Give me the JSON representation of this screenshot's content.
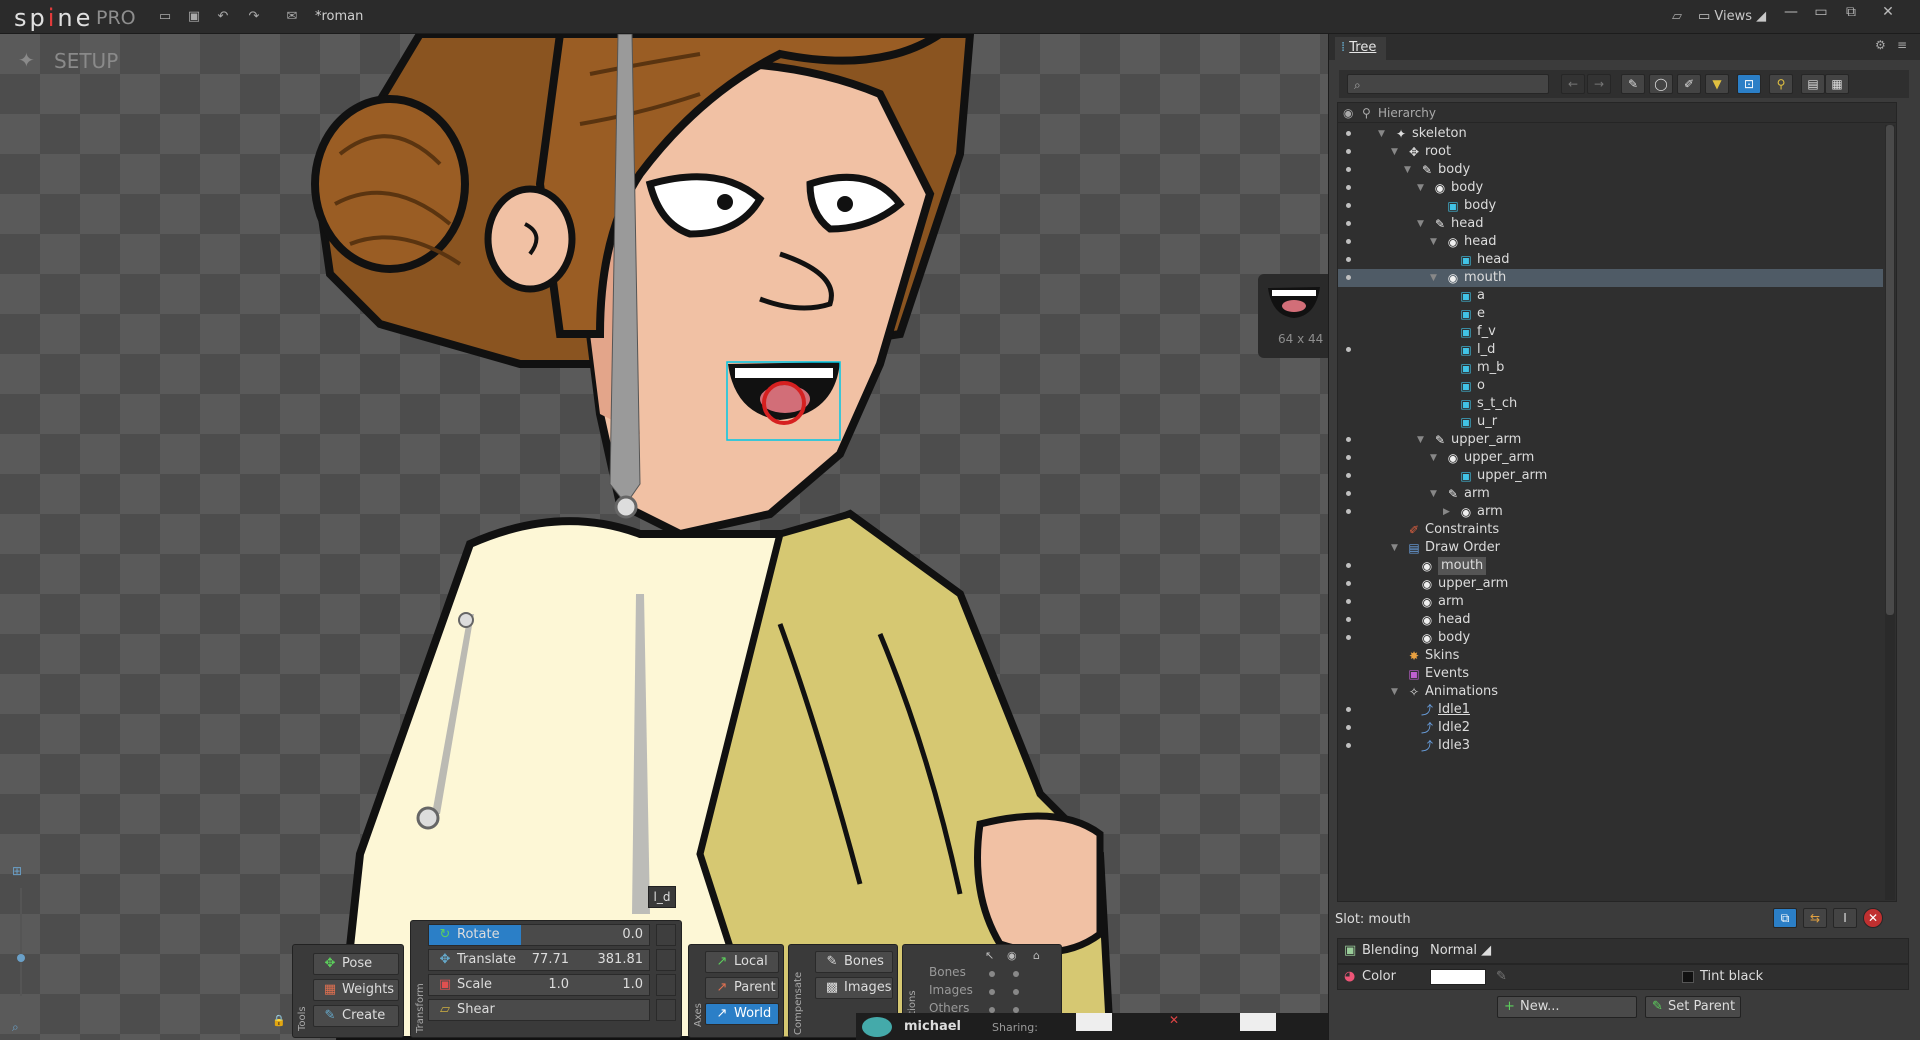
{
  "app": {
    "logo": "spine",
    "edition": "PRO",
    "filename": "*roman",
    "views_label": "Views"
  },
  "colors": {
    "accent": "#2b7fc7",
    "attachment": "#41c3e6",
    "selection": "#4f5b66",
    "bound_box": "#00c8e6",
    "handle_red": "#d62020"
  },
  "viewport": {
    "mode_label": "SETUP",
    "image_size_label": "64 x 44",
    "bone_tag": "l_d"
  },
  "tools": {
    "section_label": "Tools",
    "pose": "Pose",
    "weights": "Weights",
    "create": "Create"
  },
  "transform": {
    "section_label": "Transform",
    "rotate": {
      "label": "Rotate",
      "value": "0.0"
    },
    "translate": {
      "label": "Translate",
      "x": "77.71",
      "y": "381.81"
    },
    "scale": {
      "label": "Scale",
      "x": "1.0",
      "y": "1.0"
    },
    "shear": {
      "label": "Shear",
      "x": "",
      "y": ""
    }
  },
  "axes": {
    "section_label": "Axes",
    "local": "Local",
    "parent": "Parent",
    "world": "World"
  },
  "compensate": {
    "section_label": "Compensate",
    "bones": "Bones",
    "images": "Images"
  },
  "options": {
    "section_label": "Options",
    "bones": "Bones",
    "images": "Images",
    "others": "Others"
  },
  "bottom": {
    "user": "michael",
    "sharing": "Sharing:"
  },
  "tree": {
    "tab_label": "Tree",
    "search_placeholder": "",
    "header": "Hierarchy",
    "rows": [
      {
        "label": "skeleton",
        "icon": "skeleton-icon",
        "indent": 0,
        "arrow": "▼",
        "eye": true
      },
      {
        "label": "root",
        "icon": "root-bone-icon",
        "indent": 1,
        "arrow": "▼",
        "eye": true
      },
      {
        "label": "body",
        "icon": "bone-icon",
        "indent": 2,
        "arrow": "▼",
        "eye": true
      },
      {
        "label": "body",
        "icon": "slot-icon",
        "indent": 3,
        "arrow": "▼",
        "eye": true
      },
      {
        "label": "body",
        "icon": "region-attachment-icon",
        "indent": 4,
        "arrow": "",
        "eye": true
      },
      {
        "label": "head",
        "icon": "bone-icon",
        "indent": 3,
        "arrow": "▼",
        "eye": true
      },
      {
        "label": "head",
        "icon": "slot-icon",
        "indent": 4,
        "arrow": "▼",
        "eye": true
      },
      {
        "label": "head",
        "icon": "region-attachment-icon",
        "indent": 5,
        "arrow": "",
        "eye": true
      },
      {
        "label": "mouth",
        "icon": "slot-icon",
        "indent": 4,
        "arrow": "▼",
        "eye": true,
        "selected": true
      },
      {
        "label": "a",
        "icon": "region-attachment-icon",
        "indent": 5,
        "arrow": "",
        "eye": false
      },
      {
        "label": "e",
        "icon": "region-attachment-icon",
        "indent": 5,
        "arrow": "",
        "eye": false
      },
      {
        "label": "f_v",
        "icon": "region-attachment-icon",
        "indent": 5,
        "arrow": "",
        "eye": false
      },
      {
        "label": "l_d",
        "icon": "region-attachment-icon",
        "indent": 5,
        "arrow": "",
        "eye": true
      },
      {
        "label": "m_b",
        "icon": "region-attachment-icon",
        "indent": 5,
        "arrow": "",
        "eye": false
      },
      {
        "label": "o",
        "icon": "region-attachment-icon",
        "indent": 5,
        "arrow": "",
        "eye": false
      },
      {
        "label": "s_t_ch",
        "icon": "region-attachment-icon",
        "indent": 5,
        "arrow": "",
        "eye": false
      },
      {
        "label": "u_r",
        "icon": "region-attachment-icon",
        "indent": 5,
        "arrow": "",
        "eye": false
      },
      {
        "label": "upper_arm",
        "icon": "bone-icon",
        "indent": 3,
        "arrow": "▼",
        "eye": true
      },
      {
        "label": "upper_arm",
        "icon": "slot-icon",
        "indent": 4,
        "arrow": "▼",
        "eye": true
      },
      {
        "label": "upper_arm",
        "icon": "region-attachment-icon",
        "indent": 5,
        "arrow": "",
        "eye": true
      },
      {
        "label": "arm",
        "icon": "bone-icon",
        "indent": 4,
        "arrow": "▼",
        "eye": true
      },
      {
        "label": "arm",
        "icon": "slot-icon",
        "indent": 5,
        "arrow": "▶",
        "eye": true
      },
      {
        "label": "Constraints",
        "icon": "constraints-icon",
        "indent": 1,
        "arrow": "",
        "eye": false
      },
      {
        "label": "Draw Order",
        "icon": "draw-order-icon",
        "indent": 1,
        "arrow": "▼",
        "eye": false
      },
      {
        "label": "mouth",
        "icon": "slot-icon",
        "indent": 2,
        "arrow": "",
        "eye": true,
        "highlight": true
      },
      {
        "label": "upper_arm",
        "icon": "slot-icon",
        "indent": 2,
        "arrow": "",
        "eye": true
      },
      {
        "label": "arm",
        "icon": "slot-icon",
        "indent": 2,
        "arrow": "",
        "eye": true
      },
      {
        "label": "head",
        "icon": "slot-icon",
        "indent": 2,
        "arrow": "",
        "eye": true
      },
      {
        "label": "body",
        "icon": "slot-icon",
        "indent": 2,
        "arrow": "",
        "eye": true
      },
      {
        "label": "Skins",
        "icon": "skins-icon",
        "indent": 1,
        "arrow": "",
        "eye": false
      },
      {
        "label": "Events",
        "icon": "events-icon",
        "indent": 1,
        "arrow": "",
        "eye": false
      },
      {
        "label": "Animations",
        "icon": "animations-icon",
        "indent": 1,
        "arrow": "▼",
        "eye": false
      },
      {
        "label": "Idle1",
        "icon": "animation-icon",
        "indent": 2,
        "arrow": "",
        "eye": true,
        "underline": true
      },
      {
        "label": "Idle2",
        "icon": "animation-icon",
        "indent": 2,
        "arrow": "",
        "eye": true
      },
      {
        "label": "Idle3",
        "icon": "animation-icon",
        "indent": 2,
        "arrow": "",
        "eye": true
      }
    ]
  },
  "slot": {
    "title": "Slot: mouth",
    "blending_label": "Blending",
    "blending_value": "Normal",
    "color_label": "Color",
    "color_value": "#ffffff",
    "tint_black_label": "Tint black",
    "new_button": "New...",
    "set_parent_button": "Set Parent"
  }
}
